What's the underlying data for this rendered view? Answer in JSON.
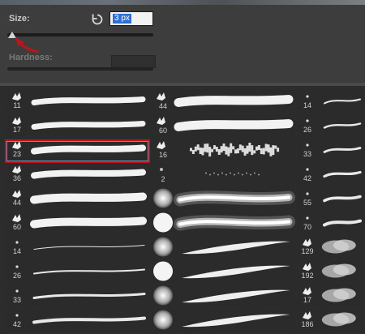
{
  "size": {
    "label": "Size:",
    "value": "3 px"
  },
  "hardness": {
    "label": "Hardness:"
  },
  "icons": {
    "reset": "reset-arrow-icon",
    "annotation": "red-arrow-icon"
  },
  "colors": {
    "selection": "#c0141b",
    "highlight": "#2e6fd6"
  },
  "brushes": {
    "col1": [
      "11",
      "17",
      "23",
      "36",
      "44",
      "60",
      "14",
      "26",
      "33",
      "42"
    ],
    "col2": [
      "44",
      "60",
      "16",
      "2",
      "",
      "",
      "",
      "",
      "",
      ""
    ],
    "col3": [
      "14",
      "26",
      "33",
      "42",
      "55",
      "70",
      "129",
      "192",
      "17",
      "186"
    ]
  },
  "selected_brush": "23"
}
